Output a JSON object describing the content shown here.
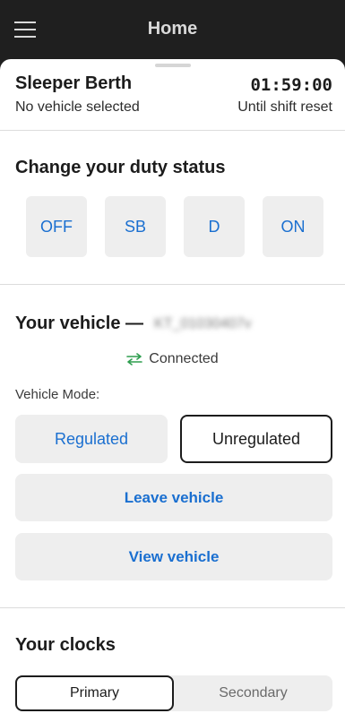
{
  "header": {
    "title": "Home"
  },
  "status": {
    "current": "Sleeper Berth",
    "vehicle_note": "No vehicle selected",
    "timer": "01:59:00",
    "timer_label": "Until shift reset"
  },
  "duty": {
    "heading": "Change your duty status",
    "buttons": [
      {
        "label": "OFF"
      },
      {
        "label": "SB"
      },
      {
        "label": "D"
      },
      {
        "label": "ON"
      }
    ]
  },
  "vehicle": {
    "heading": "Your vehicle —",
    "id": "KT_01030407v",
    "connection": "Connected",
    "mode_label": "Vehicle Mode:",
    "modes": [
      {
        "label": "Regulated",
        "selected": false
      },
      {
        "label": "Unregulated",
        "selected": true
      }
    ],
    "leave_label": "Leave vehicle",
    "view_label": "View vehicle"
  },
  "clocks": {
    "heading": "Your clocks",
    "tabs": [
      {
        "label": "Primary",
        "selected": true
      },
      {
        "label": "Secondary",
        "selected": false
      }
    ]
  },
  "colors": {
    "accent": "#1a6fd0",
    "connected": "#2e9e4f",
    "topbar": "#1f1f1f"
  }
}
